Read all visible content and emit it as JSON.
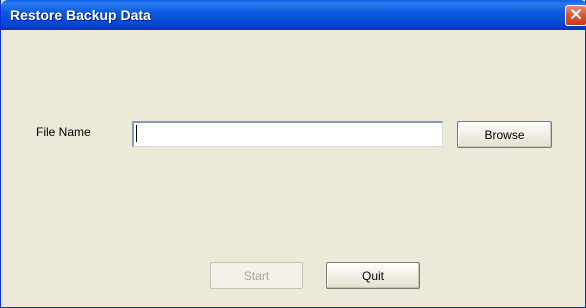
{
  "window": {
    "title": "Restore Backup Data"
  },
  "form": {
    "file_name_label": "File Name",
    "file_name_value": "",
    "browse_label": "Browse"
  },
  "actions": {
    "start_label": "Start",
    "start_enabled": false,
    "quit_label": "Quit"
  },
  "icons": {
    "close": "close-icon"
  },
  "colors": {
    "titlebar": "#0347d4",
    "window_bg": "#ece9d8",
    "close_btn": "#d9552f"
  }
}
